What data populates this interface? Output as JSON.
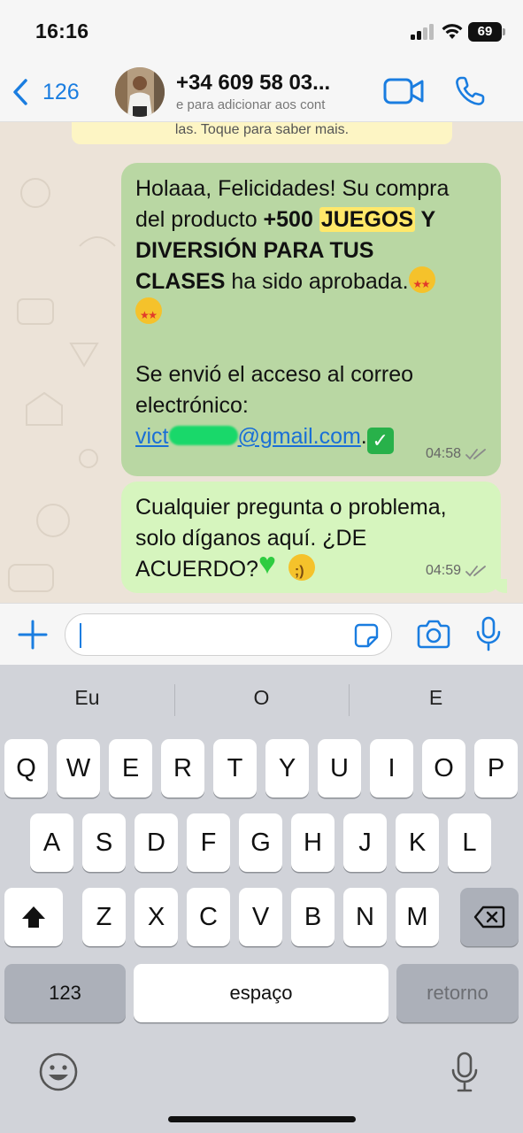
{
  "status_bar": {
    "time": "16:16",
    "battery": "69",
    "icons": [
      "signal-icon",
      "wifi-icon",
      "battery-icon"
    ]
  },
  "header": {
    "back_count": "126",
    "contact_name": "+34 609 58 03...",
    "contact_subtitle": "e para adicionar aos cont",
    "icons": [
      "back-chevron-icon",
      "avatar",
      "video-call-icon",
      "phone-icon"
    ]
  },
  "chat": {
    "notice_text": "las. Toque para saber mais.",
    "messages": [
      {
        "line1": "Holaaa, Felicidades! Su compra",
        "line2_pre": "del producto ",
        "line2_bold": "+500 ",
        "line2_highlight": "JUEGOS",
        "line2_post": " Y",
        "line3": "DIVERSIÓN PARA TUS",
        "line4_bold": "CLASES",
        "line4_rest": " ha sido aprobada.",
        "line5": "Se envió el acceso al correo",
        "line6": "electrónico:",
        "email_start": "vict",
        "email_end": "@gmail.com",
        "email_dot": ".",
        "time": "04:58"
      },
      {
        "line1": "Cualquier pregunta o problema,",
        "line2": "solo díganos aquí. ¿DE",
        "line3": "ACUERDO?",
        "time": "04:59"
      }
    ]
  },
  "input_bar": {
    "value": "",
    "icons": [
      "plus-icon",
      "sticker-icon",
      "camera-icon",
      "microphone-icon"
    ]
  },
  "keyboard": {
    "suggestions": [
      "Eu",
      "O",
      "E"
    ],
    "row1": [
      "Q",
      "W",
      "E",
      "R",
      "T",
      "Y",
      "U",
      "I",
      "O",
      "P"
    ],
    "row2": [
      "A",
      "S",
      "D",
      "F",
      "G",
      "H",
      "J",
      "K",
      "L"
    ],
    "row3": [
      "Z",
      "X",
      "C",
      "V",
      "B",
      "N",
      "M"
    ],
    "numbers_key": "123",
    "space_key": "espaço",
    "return_key": "retorno",
    "icons": [
      "shift-icon",
      "backspace-icon",
      "emoji-icon",
      "dictation-icon"
    ]
  },
  "colors": {
    "accent_blue": "#1a7de0",
    "bubble_selected": "#b9d7a3",
    "bubble_outgoing": "#d6f5be",
    "highlight": "#ffe86a",
    "keyboard_bg": "#d1d3d9"
  }
}
